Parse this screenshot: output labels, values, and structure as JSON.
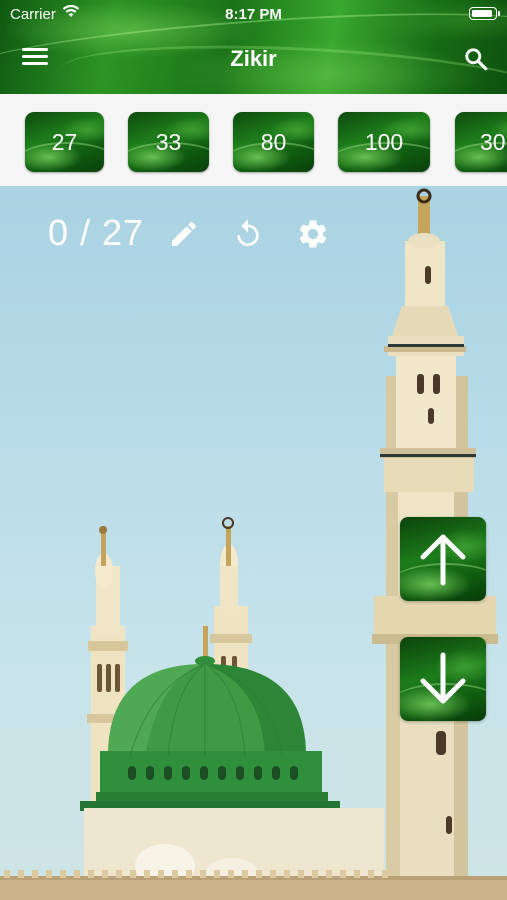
{
  "status_bar": {
    "carrier": "Carrier",
    "time": "8:17 PM",
    "battery_level": 0.9
  },
  "header": {
    "title": "Zikir",
    "menu_icon": "hamburger-menu-icon",
    "search_icon": "search-icon"
  },
  "presets": [
    {
      "label": "27"
    },
    {
      "label": "33"
    },
    {
      "label": "80"
    },
    {
      "label": "100"
    },
    {
      "label": "30"
    }
  ],
  "counter": {
    "text": "0 / 27",
    "current": 0,
    "target": 27
  },
  "toolbar": {
    "edit_icon": "pencil-icon",
    "reset_icon": "reset-icon",
    "settings_icon": "gear-icon"
  },
  "controls": {
    "up_icon": "arrow-up-icon",
    "down_icon": "arrow-down-icon"
  },
  "colors": {
    "brand_green": "#1d7c1a",
    "dome_green": "#2f8f3c",
    "sky": "#b8dce8"
  }
}
